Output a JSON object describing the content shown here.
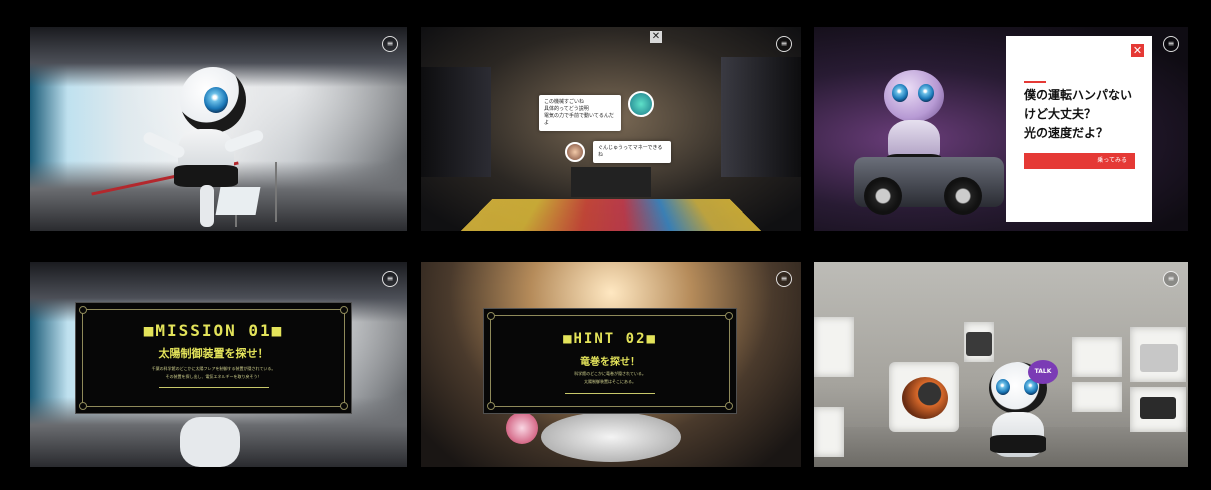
{
  "panels": [
    {
      "id": "p1",
      "scene": "museum lobby with mascot robot",
      "menu_icon": "hamburger-menu-icon"
    },
    {
      "id": "p2",
      "scene": "exhibition hall with chat bubbles",
      "close_icon": "close-icon",
      "bubble1": "この機械すごいね\n具体的ってどう説明\n電気の力で手前で動いてるんだよ",
      "bubble2": "ぐんじゅうってマネーできるね",
      "menu_icon": "hamburger-menu-icon"
    },
    {
      "id": "p3",
      "scene": "garage with robot and car",
      "popup": {
        "question": "僕の運転ハンパない\nけど大丈夫？\n光の速度だよ？",
        "cta": "乗ってみる",
        "close_icon": "close-icon"
      },
      "menu_icon": "hamburger-menu-icon"
    },
    {
      "id": "p4",
      "scene": "lobby with mission board",
      "board": {
        "title": "■MISSION 01■",
        "subtitle": "太陽制御装置を探せ！",
        "desc1": "千葉の科学館のどこかに太陽フレアを制御する装置が隠されている。",
        "desc2": "その装置を探し出し、電気エネルギーを取り戻そう！"
      },
      "menu_icon": "hamburger-menu-icon"
    },
    {
      "id": "p5",
      "scene": "round exhibit with hint board",
      "board": {
        "title": "■HINT 02■",
        "subtitle": "竜巻を探せ！",
        "desc1": "科学館のどこかに竜巻が隠されている。",
        "desc2": "太陽制御装置はそこにある。"
      },
      "menu_icon": "hamburger-menu-icon"
    },
    {
      "id": "p6",
      "scene": "appliance display room",
      "talk": "TALK",
      "menu_icon": "hamburger-menu-icon"
    }
  ],
  "colors": {
    "accent_red": "#e53935",
    "board_yellow": "#e3e35a",
    "talk_purple": "#7b3bb5"
  }
}
